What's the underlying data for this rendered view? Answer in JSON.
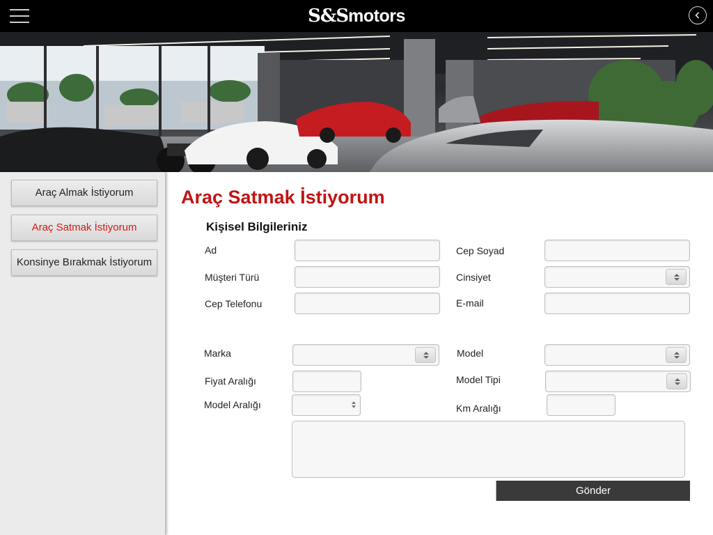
{
  "header": {
    "logo_part1": "S&S",
    "logo_part2": "motors"
  },
  "sidebar": {
    "items": [
      {
        "label": "Araç Almak İstiyorum",
        "active": false
      },
      {
        "label": "Araç Satmak İstiyorum",
        "active": true
      },
      {
        "label": "Konsinye Bırakmak İstiyorum",
        "active": false
      }
    ]
  },
  "main": {
    "title": "Araç Satmak İstiyorum",
    "section_title": "Kişisel Bilgileriniz",
    "fields": {
      "ad": {
        "label": "Ad",
        "value": ""
      },
      "cep_soyad": {
        "label": "Cep Soyad",
        "value": ""
      },
      "musteri_turu": {
        "label": "Müşteri Türü",
        "value": ""
      },
      "cinsiyet": {
        "label": "Cinsiyet",
        "value": ""
      },
      "cep_telefonu": {
        "label": "Cep Telefonu",
        "value": ""
      },
      "email": {
        "label": "E-mail",
        "value": ""
      },
      "marka": {
        "label": "Marka",
        "value": ""
      },
      "model": {
        "label": "Model",
        "value": ""
      },
      "fiyat_araligi": {
        "label": "Fiyat Aralığı",
        "value": ""
      },
      "model_tipi": {
        "label": "Model Tipi",
        "value": ""
      },
      "model_araligi": {
        "label": "Model Aralığı",
        "value": ""
      },
      "km_araligi": {
        "label": "Km Aralığı",
        "value": ""
      }
    },
    "submit_label": "Gönder"
  },
  "colors": {
    "accent_red": "#c01414",
    "topbar": "#000000",
    "submit_bg": "#3a3a3a"
  }
}
